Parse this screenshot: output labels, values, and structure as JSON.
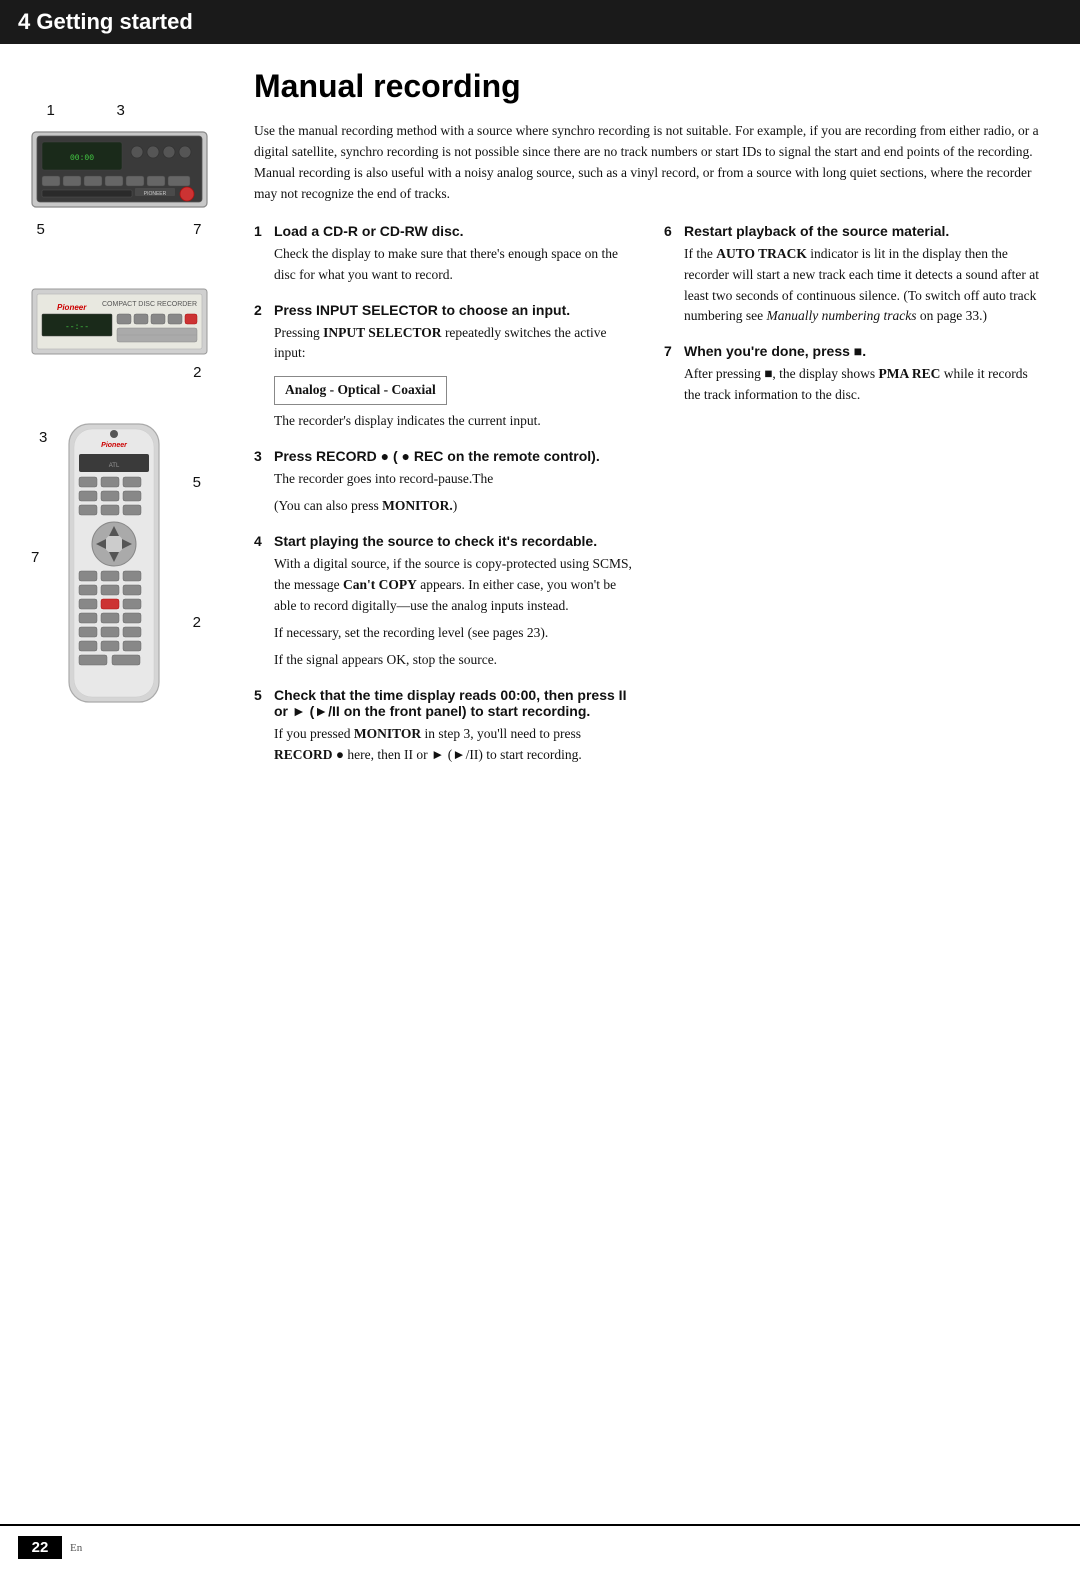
{
  "chapter": {
    "number": 4,
    "title": "4 Getting started"
  },
  "page": {
    "title": "Manual recording",
    "number": "22",
    "lang": "En"
  },
  "intro": "Use the manual recording method with a source where synchro recording is not suitable. For example, if you are recording from either radio, or a digital satellite, synchro recording is not possible since there are no track numbers or start IDs to signal the start and end points of the recording. Manual recording is also useful with a noisy analog source, such as a vinyl record, or from a source with long quiet sections, where the recorder may not recognize the end of tracks.",
  "steps": [
    {
      "number": "1",
      "heading": "Load a CD-R or CD-RW disc.",
      "body": "Check the display to make sure that there's enough space on the disc for what you want to record."
    },
    {
      "number": "2",
      "heading": "Press INPUT SELECTOR to choose an input.",
      "body_pre": "Pressing ",
      "body_bold1": "INPUT SELECTOR",
      "body_mid": " repeatedly switches the active input:",
      "input_options": "Analog - Optical -  Coaxial",
      "body_post": "The recorder's display indicates the current input."
    },
    {
      "number": "3",
      "heading": "Press RECORD ● ( ● REC on the remote control).",
      "body1": "The recorder goes into record-pause.The",
      "body2": "(You can also press ",
      "body2_bold": "MONITOR.",
      "body2_end": ")"
    },
    {
      "number": "4",
      "heading": "Start playing the source to check it's recordable.",
      "body1": "With a digital source, if the source is copy-protected using SCMS, the message ",
      "bold1": "Can't COPY",
      "body1b": " appears. In either case, you won't be able to record digitally—use the analog inputs instead.",
      "body2": "If necessary, set the recording level (see pages 23).",
      "body3": "If the signal appears OK, stop the source."
    },
    {
      "number": "5",
      "heading": "Check that the time display reads 00:00, then press II or ► (►/II on the front panel) to start recording.",
      "body1": "If you pressed ",
      "bold1": "MONITOR",
      "body1b": " in step 3, you'll need to press ",
      "bold2": "RECORD ●",
      "body1c": " here, then II or ► (►/II) to start recording."
    },
    {
      "number": "6",
      "heading": "Restart playback of the source material.",
      "body1": "If the ",
      "bold1": "AUTO TRACK",
      "body1b": " indicator is lit in the display then the recorder will start a new track each time it detects a sound after at least two seconds of continuous silence. (To switch off auto track numbering see ",
      "italic1": "Manually numbering tracks",
      "body1c": " on page 33.)"
    },
    {
      "number": "7",
      "heading": "When you're done, press ■.",
      "body1": "After pressing ■, the display shows ",
      "bold1": "PMA REC",
      "body1b": " while it records the track information to the disc."
    }
  ],
  "device_labels": {
    "label1": "1",
    "label2": "3",
    "label3": "5",
    "label4": "7",
    "label5": "2",
    "label6": "3",
    "label7": "5",
    "label8": "7",
    "label9": "2"
  }
}
